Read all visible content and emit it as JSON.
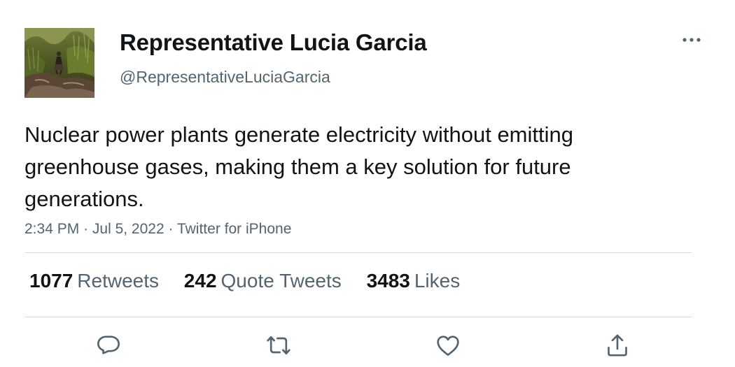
{
  "author": {
    "display_name": "Representative Lucia Garcia",
    "handle": "@RepresentativeLuciaGarcia",
    "avatar_icon": "profile-photo"
  },
  "tweet": {
    "text": "Nuclear power plants generate electricity without emitting greenhouse gases, making them a key solution for future generations.",
    "time": "2:34 PM",
    "date": "Jul 5, 2022",
    "source": "Twitter for iPhone",
    "separator": "·"
  },
  "stats": {
    "retweets": {
      "count": "1077",
      "label": "Retweets"
    },
    "quotes": {
      "count": "242",
      "label": "Quote Tweets"
    },
    "likes": {
      "count": "3483",
      "label": "Likes"
    }
  },
  "actions": [
    {
      "name": "reply",
      "icon": "reply-icon"
    },
    {
      "name": "retweet",
      "icon": "retweet-icon"
    },
    {
      "name": "like",
      "icon": "heart-icon"
    },
    {
      "name": "share",
      "icon": "share-icon"
    }
  ],
  "colors": {
    "text": "#0f1419",
    "secondary": "#536471",
    "divider": "#cfd9de"
  }
}
